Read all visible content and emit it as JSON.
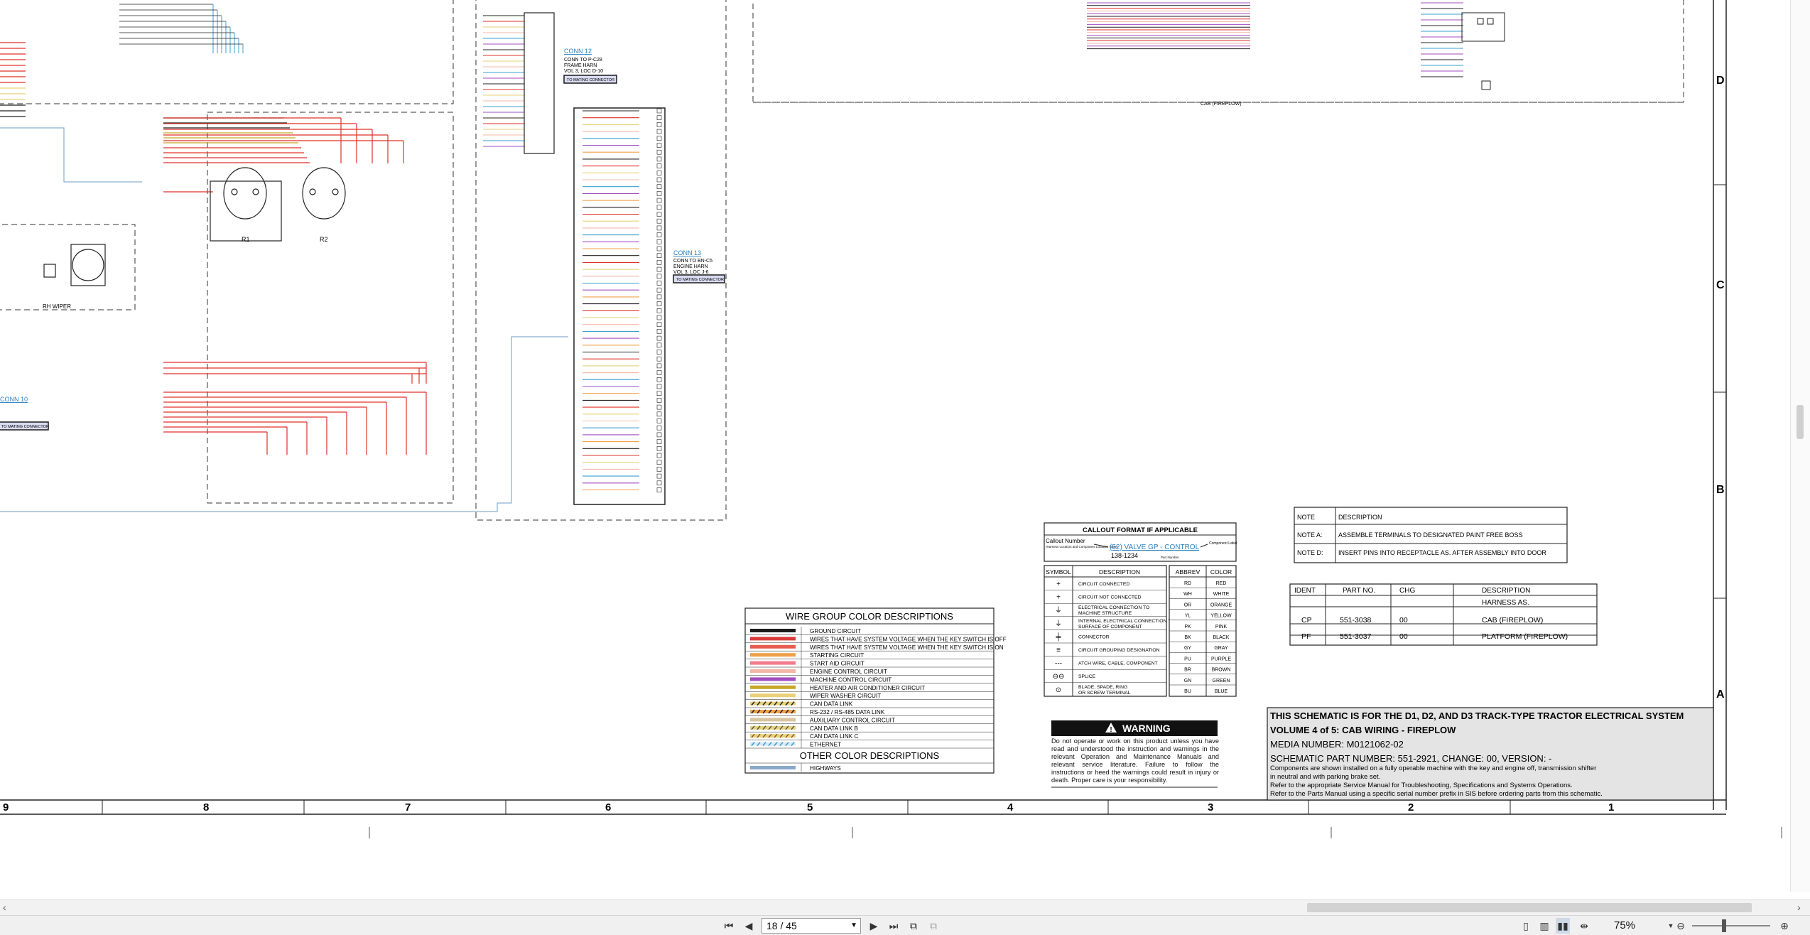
{
  "document": {
    "zone_letters": [
      "D",
      "C",
      "B",
      "A"
    ],
    "zone_numbers": [
      "9",
      "8",
      "7",
      "6",
      "5",
      "4",
      "3",
      "2",
      "1"
    ],
    "connectors": {
      "conn12": {
        "title": "CONN 12",
        "lines": [
          "CONN TO P-C28",
          "FRAME HARN",
          "VOL 3, LOC D-10"
        ],
        "tag": "TO MATING CONNECTOR"
      },
      "conn13": {
        "title": "CONN 13",
        "lines": [
          "CONN TO BN-C5",
          "ENGINE HARN",
          "VOL 3, LOC J-6"
        ],
        "tag": "TO MATING CONNECTOR"
      },
      "conn10": {
        "title": "CONN 10",
        "tag": "TO MATING CONNECTOR"
      },
      "rh_wiper": "RH WIPER",
      "cab_label": "CAB (FIREPLOW)",
      "relay_r1": "R1",
      "relay_r2": "R2"
    },
    "wire_group": {
      "title": "WIRE GROUP COLOR DESCRIPTIONS",
      "rows": [
        {
          "color": "#1a1a1a",
          "label": "GROUND CIRCUIT"
        },
        {
          "color": "#d83a3a",
          "label": "WIRES THAT HAVE SYSTEM VOLTAGE WHEN THE KEY SWITCH IS OFF"
        },
        {
          "color": "#e85b4f",
          "label": "WIRES THAT HAVE SYSTEM VOLTAGE WHEN THE KEY SWITCH IS ON"
        },
        {
          "color": "#f0a14a",
          "label": "STARTING CIRCUIT"
        },
        {
          "color": "#f07a8a",
          "label": "START AID CIRCUIT"
        },
        {
          "color": "#f3b7a8",
          "label": "ENGINE CONTROL CIRCUIT"
        },
        {
          "color": "#a04ec0",
          "label": "MACHINE CONTROL CIRCUIT"
        },
        {
          "color": "#c8a72a",
          "label": "HEATER AND AIR CONDITIONER CIRCUIT"
        },
        {
          "color": "#e7d27a",
          "label": "WIPER WASHER CIRCUIT"
        },
        {
          "color": "hatch1",
          "label": "CAN DATA LINK"
        },
        {
          "color": "hatch2",
          "label": "RS-232 / RS-485 DATA LINK"
        },
        {
          "color": "#d7c4a0",
          "label": "AUXILIARY CONTROL CIRCUIT"
        },
        {
          "color": "hatch3",
          "label": "CAN DATA LINK B"
        },
        {
          "color": "hatch4",
          "label": "CAN DATA LINK C"
        },
        {
          "color": "hatch5",
          "label": "ETHERNET"
        }
      ],
      "other_title": "OTHER COLOR DESCRIPTIONS",
      "other_rows": [
        {
          "color": "#8aa9c8",
          "label": "HIGHWAYS"
        }
      ]
    },
    "callout": {
      "title": "CALLOUT FORMAT IF APPLICABLE",
      "callout_number": "Callout Number",
      "callout_sub": "(Harness Location and Component Location Table)",
      "link": "(52) VALVE GP - CONTROL",
      "part": "138-1234",
      "component_label": "Component Label",
      "part_number": "Part Number"
    },
    "symbols": {
      "headers": [
        "SYMBOL",
        "DESCRIPTION"
      ],
      "rows": [
        {
          "glyph": "+",
          "desc": "CIRCUIT CONNECTED"
        },
        {
          "glyph": "+",
          "desc": "CIRCUIT NOT CONNECTED"
        },
        {
          "glyph": "⏚",
          "desc": "ELECTRICAL CONNECTION TO MACHINE STRUCTURE"
        },
        {
          "glyph": "⏚",
          "desc": "INTERNAL ELECTRICAL CONNECTION TO SURFACE OF COMPONENT"
        },
        {
          "glyph": "╪",
          "desc": "CONNECTOR"
        },
        {
          "glyph": "≡",
          "desc": "CIRCUIT GROUPING DESIGNATION"
        },
        {
          "glyph": "---",
          "desc": "ATCH WIRE, CABLE, COMPONENT"
        },
        {
          "glyph": "⊖⊖",
          "desc": "SPLICE"
        },
        {
          "glyph": "⊙",
          "desc": "BLADE, SPADE, RING OR SCREW TERMINAL"
        }
      ]
    },
    "abbrev": {
      "headers": [
        "ABBREV",
        "COLOR"
      ],
      "rows": [
        [
          "RD",
          "RED"
        ],
        [
          "WH",
          "WHITE"
        ],
        [
          "OR",
          "ORANGE"
        ],
        [
          "YL",
          "YELLOW"
        ],
        [
          "PK",
          "PINK"
        ],
        [
          "BK",
          "BLACK"
        ],
        [
          "GY",
          "GRAY"
        ],
        [
          "PU",
          "PURPLE"
        ],
        [
          "BR",
          "BROWN"
        ],
        [
          "GN",
          "GREEN"
        ],
        [
          "BU",
          "BLUE"
        ]
      ]
    },
    "notes": {
      "header": [
        "NOTE",
        "DESCRIPTION"
      ],
      "rows": [
        [
          "NOTE A:",
          "ASSEMBLE TERMINALS TO DESIGNATED PAINT FREE BOSS"
        ],
        [
          "NOTE D:",
          "INSERT PINS INTO RECEPTACLE AS. AFTER ASSEMBLY INTO DOOR"
        ]
      ]
    },
    "harness": {
      "header": [
        "IDENT",
        "PART NO.",
        "CHG",
        "DESCRIPTION"
      ],
      "sub": "HARNESS AS.",
      "rows": [
        [
          "CP",
          "551-3038",
          "00",
          "CAB (FIREPLOW)"
        ],
        [
          "PF",
          "551-3037",
          "00",
          "PLATFORM (FIREPLOW)"
        ]
      ]
    },
    "warning": {
      "title": "WARNING",
      "text": "Do not operate or work on this product unless you have read and understood the instruction and warnings in the relevant Operation and Maintenance Manuals and relevant service literature. Failure to follow the instructions or heed the warnings could result in injury or death. Proper care is your responsibility."
    },
    "title_block": {
      "line1": "THIS SCHEMATIC IS FOR THE D1, D2, AND D3 TRACK-TYPE TRACTOR ELECTRICAL SYSTEM",
      "line2": "VOLUME 4 of 5: CAB WIRING - FIREPLOW",
      "line3": "MEDIA NUMBER: M0121062-02",
      "line4": "SCHEMATIC PART NUMBER: 551-2921, CHANGE: 00, VERSION: -",
      "line5": "Components are shown installed on a fully operable machine with the key and engine off, transmission shifter",
      "line6": "in neutral and with parking brake set.",
      "line7": "Refer to the appropriate Service Manual for Troubleshooting, Specifications and Systems Operations.",
      "line8": "Refer to the Parts Manual using a specific serial number prefix in SIS before ordering parts from this schematic."
    }
  },
  "toolbar": {
    "page": "18 / 45",
    "zoom": "75%"
  },
  "colors": {
    "toolbar_bg": "#f0f0f0",
    "red_wire": "#e0302a",
    "blue_highway": "#6d9ec6"
  }
}
